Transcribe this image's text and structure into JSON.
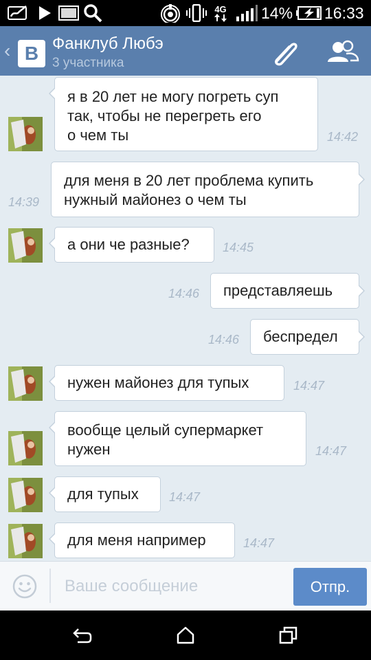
{
  "status_bar": {
    "battery_percent": "14%",
    "time": "16:33",
    "network_type": "4G",
    "icons": [
      "signature-icon",
      "play-icon",
      "image-icon",
      "search-icon",
      "hotspot-icon",
      "vibrate-icon",
      "network-4g-icon",
      "signal-icon",
      "battery-charging-icon"
    ]
  },
  "header": {
    "title": "Фанклуб Любэ",
    "subtitle": "3 участника",
    "logo_letter": "B"
  },
  "messages": [
    {
      "direction": "in",
      "lines": [
        "я в 20 лет не могу погреть суп",
        "так, чтобы не перегреть его",
        "о чем ты"
      ],
      "time": "14:42"
    },
    {
      "direction": "out",
      "lines": [
        "для меня в 20 лет проблема купить",
        "нужный майонез о чем ты"
      ],
      "time": "14:39"
    },
    {
      "direction": "in",
      "lines": [
        "а они че разные?"
      ],
      "time": "14:45"
    },
    {
      "direction": "out",
      "lines": [
        "представляешь"
      ],
      "time": "14:46"
    },
    {
      "direction": "out",
      "lines": [
        "беспредел"
      ],
      "time": "14:46"
    },
    {
      "direction": "in",
      "lines": [
        "нужен майонез для тупых"
      ],
      "time": "14:47"
    },
    {
      "direction": "in",
      "lines": [
        "вообще целый супермаркет",
        "нужен"
      ],
      "time": "14:47"
    },
    {
      "direction": "in",
      "lines": [
        "для тупых"
      ],
      "time": "14:47"
    },
    {
      "direction": "in",
      "lines": [
        "для меня например"
      ],
      "time": "14:47"
    }
  ],
  "composer": {
    "placeholder": "Ваше сообщение",
    "value": "",
    "send_label": "Отпр."
  },
  "colors": {
    "header": "#5a7fad",
    "chat_background": "#e4ecf2",
    "send_button": "#5c8bc9",
    "timestamp": "#a9b8c8"
  }
}
